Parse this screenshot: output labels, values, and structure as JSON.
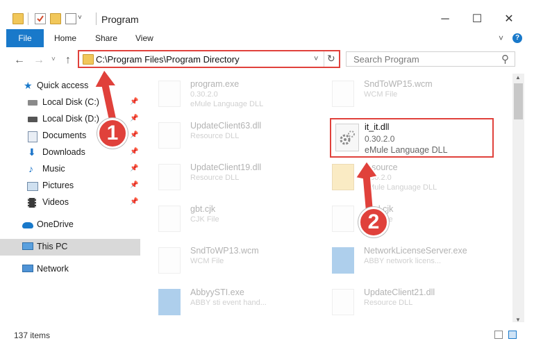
{
  "window": {
    "title": "Program",
    "minimize_glyph": "─",
    "maximize_glyph": "☐",
    "close_glyph": "✕",
    "colors": {
      "accent": "#1979ca",
      "highlight": "#e0413b",
      "folder": "#f1c75a"
    }
  },
  "ribbon": {
    "tabs": [
      "File",
      "Home",
      "Share",
      "View"
    ],
    "expand_glyph": "˅",
    "help_glyph": "?"
  },
  "navigation": {
    "back_glyph": "←",
    "forward_glyph": "→",
    "recent_glyph": "˅",
    "up_glyph": "↑",
    "address": "C:\\Program Files\\Program Directory",
    "refresh_glyph": "↻",
    "search_placeholder": "Search Program",
    "search_glyph": "⚲"
  },
  "sidebar": {
    "quick_access": "Quick access",
    "items": [
      {
        "label": "Local Disk (C:)",
        "icon": "drive-icon"
      },
      {
        "label": "Local Disk (D:)",
        "icon": "drive-icon"
      },
      {
        "label": "Documents",
        "icon": "documents-icon"
      },
      {
        "label": "Downloads",
        "icon": "downloads-icon"
      },
      {
        "label": "Music",
        "icon": "music-icon"
      },
      {
        "label": "Pictures",
        "icon": "pictures-icon"
      },
      {
        "label": "Videos",
        "icon": "videos-icon"
      }
    ],
    "onedrive": "OneDrive",
    "this_pc": "This PC",
    "network": "Network"
  },
  "files": {
    "left": [
      {
        "name": "program.exe",
        "version": "0.30.2.0",
        "type": "eMule Language DLL"
      },
      {
        "name": "UpdateClient63.dll",
        "version": "",
        "type": "Resource DLL"
      },
      {
        "name": "UpdateClient19.dll",
        "version": "",
        "type": "Resource DLL"
      },
      {
        "name": "gbt.cjk",
        "version": "",
        "type": "CJK File"
      },
      {
        "name": "SndToWP13.wcm",
        "version": "",
        "type": "WCM File"
      },
      {
        "name": "AbbyySTI.exe",
        "version": "",
        "type": "ABBY sti event hand..."
      }
    ],
    "right": [
      {
        "name": "SndToWP15.wcm",
        "version": "",
        "type": "WCM File"
      },
      {
        "name": "resource",
        "version": "0.30.2.0",
        "type": "eMule Language DLL"
      },
      {
        "name": "html.cjk",
        "version": "",
        "type": "CJK File"
      },
      {
        "name": "NetworkLicenseServer.exe",
        "version": "",
        "type": "ABBY network licens..."
      },
      {
        "name": "UpdateClient21.dll",
        "version": "",
        "type": "Resource DLL"
      }
    ],
    "highlighted": {
      "name": "it_it.dll",
      "version": "0.30.2.0",
      "type": "eMule Language DLL"
    }
  },
  "status": {
    "count": "137 items"
  },
  "annotations": {
    "step1": "1",
    "step2": "2"
  }
}
